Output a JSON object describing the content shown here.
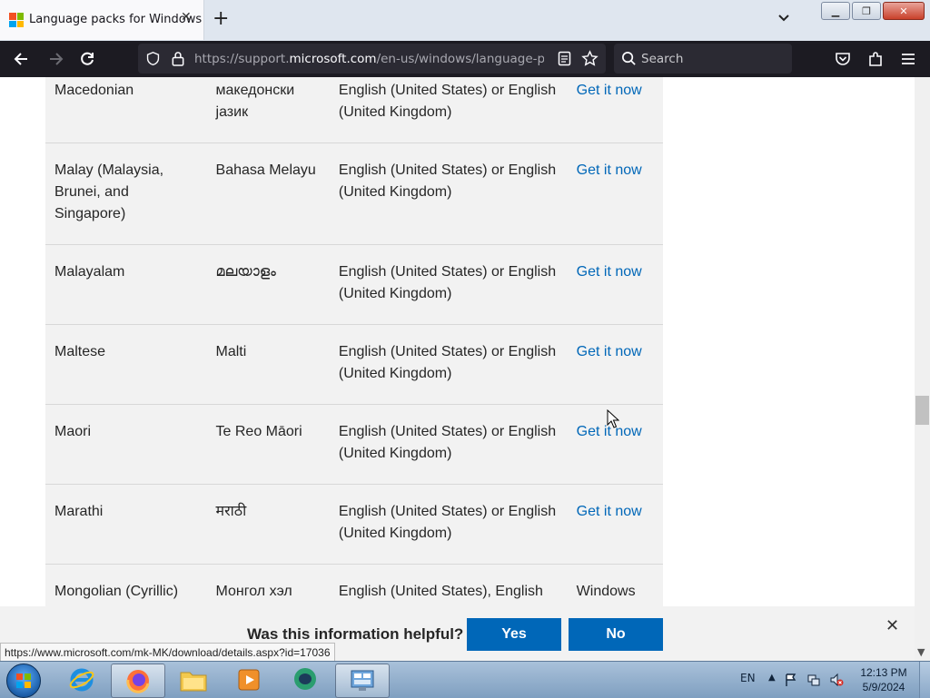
{
  "browser": {
    "tab_title": "Language packs for Windows",
    "url_prefix": "https://support.",
    "url_domain": "microsoft.com",
    "url_rest": "/en-us/windows/language-packs-",
    "search_placeholder": "Search",
    "colors": {
      "tabstrip": "#dfe6ef",
      "toolbar": "#1c1b22"
    }
  },
  "table": {
    "rows": [
      {
        "language": "Macedonian",
        "native": "македонски јазик",
        "base": "English (United States) or English (United Kingdom)",
        "action": "Get it now"
      },
      {
        "language": "Malay (Malaysia, Brunei, and Singapore)",
        "native": "Bahasa Melayu",
        "base": "English (United States) or English (United Kingdom)",
        "action": "Get it now"
      },
      {
        "language": "Malayalam",
        "native": "മലയാളം",
        "base": "English (United States) or English (United Kingdom)",
        "action": "Get it now"
      },
      {
        "language": "Maltese",
        "native": "Malti",
        "base": "English (United States) or English (United Kingdom)",
        "action": "Get it now"
      },
      {
        "language": "Maori",
        "native": "Te Reo Māori",
        "base": "English (United States) or English (United Kingdom)",
        "action": "Get it now"
      },
      {
        "language": "Marathi",
        "native": "मराठी",
        "base": "English (United States) or English (United Kingdom)",
        "action": "Get it now"
      },
      {
        "language": "Mongolian (Cyrillic)",
        "native": "Монгол хэл",
        "base": "English (United States), English",
        "action": "Windows"
      }
    ]
  },
  "feedback": {
    "question": "Was this information helpful?",
    "yes": "Yes",
    "no": "No",
    "button_color": "#0067b8"
  },
  "status_bar_url": "https://www.microsoft.com/mk-MK/download/details.aspx?id=17036",
  "taskbar": {
    "language": "EN",
    "time": "12:13 PM",
    "date": "5/9/2024",
    "apps": [
      "start-orb",
      "internet-explorer-icon",
      "firefox-icon",
      "file-explorer-icon",
      "media-player-icon",
      "app-icon",
      "control-panel-icon"
    ]
  }
}
